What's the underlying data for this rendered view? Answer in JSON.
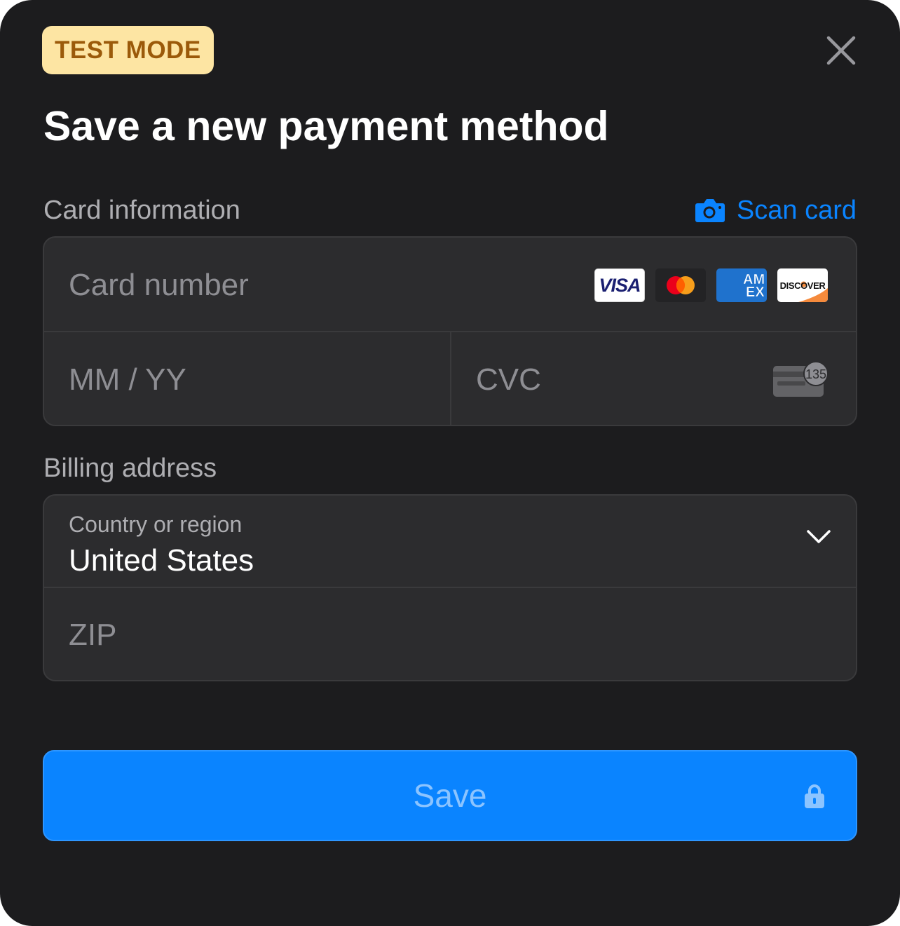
{
  "badge": {
    "label": "TEST MODE"
  },
  "header": {
    "title": "Save a new payment method",
    "close_icon": "close-icon"
  },
  "card_section": {
    "label": "Card information",
    "scan": {
      "label": "Scan card",
      "icon": "camera-icon"
    },
    "card_number": {
      "placeholder": "Card number"
    },
    "brands": {
      "visa": "VISA",
      "amex_top": "AM",
      "amex_bottom": "EX",
      "discover": "DISCOVER"
    },
    "expiry": {
      "placeholder": "MM / YY"
    },
    "cvc": {
      "placeholder": "CVC",
      "hint_number": "135"
    }
  },
  "billing_section": {
    "label": "Billing address",
    "country": {
      "caption": "Country or region",
      "value": "United States"
    },
    "zip": {
      "placeholder": "ZIP"
    }
  },
  "save_button": {
    "label": "Save",
    "icon": "lock-icon"
  },
  "colors": {
    "background": "#1c1c1e",
    "field": "#2c2c2e",
    "accent": "#0a84ff",
    "badge_bg": "#fde5a3",
    "badge_text": "#9b5a0a"
  }
}
